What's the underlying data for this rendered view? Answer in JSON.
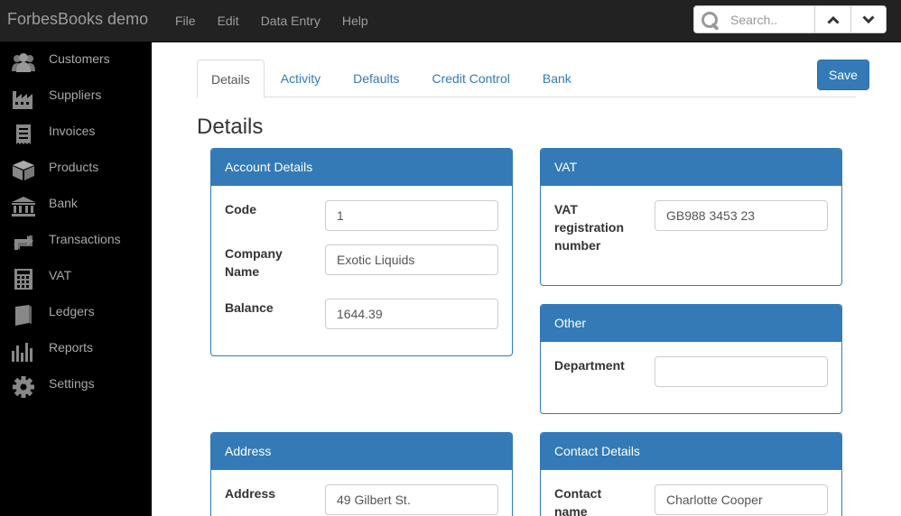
{
  "app": {
    "brand": "ForbesBooks demo"
  },
  "menu": {
    "items": [
      {
        "label": "File"
      },
      {
        "label": "Edit"
      },
      {
        "label": "Data Entry"
      },
      {
        "label": "Help"
      }
    ]
  },
  "search": {
    "placeholder": "Search.."
  },
  "sidebar": {
    "items": [
      {
        "label": "Customers",
        "icon": "users-icon"
      },
      {
        "label": "Suppliers",
        "icon": "factory-icon"
      },
      {
        "label": "Invoices",
        "icon": "receipt-icon"
      },
      {
        "label": "Products",
        "icon": "box-icon"
      },
      {
        "label": "Bank",
        "icon": "bank-icon"
      },
      {
        "label": "Transactions",
        "icon": "exchange-icon"
      },
      {
        "label": "VAT",
        "icon": "calculator-icon"
      },
      {
        "label": "Ledgers",
        "icon": "book-icon"
      },
      {
        "label": "Reports",
        "icon": "bar-chart-icon"
      },
      {
        "label": "Settings",
        "icon": "gear-icon"
      }
    ]
  },
  "tabs": [
    {
      "label": "Details"
    },
    {
      "label": "Activity"
    },
    {
      "label": "Defaults"
    },
    {
      "label": "Credit Control"
    },
    {
      "label": "Bank"
    }
  ],
  "save_label": "Save",
  "page_title": "Details",
  "account_details": {
    "heading": "Account Details",
    "code_label": "Code",
    "code_value": "1",
    "company_label": "Company Name",
    "company_value": "Exotic Liquids",
    "balance_label": "Balance",
    "balance_value": "1644.39"
  },
  "vat": {
    "heading": "VAT",
    "reg_label": "VAT registration number",
    "reg_value": "GB988 3453 23"
  },
  "other": {
    "heading": "Other",
    "department_label": "Department",
    "department_value": ""
  },
  "address": {
    "heading": "Address",
    "address_label": "Address",
    "address_value": "49 Gilbert St."
  },
  "contact": {
    "heading": "Contact Details",
    "name_label": "Contact name",
    "name_value": "Charlotte Cooper"
  },
  "colors": {
    "primary": "#337ab7",
    "navbar": "#222222",
    "sidebar": "#000000"
  }
}
